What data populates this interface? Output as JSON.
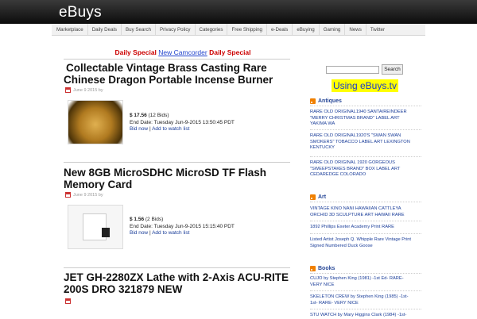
{
  "site": {
    "title": "eBuys"
  },
  "nav": [
    "Marketplace",
    "Daily Deals",
    "Buy Search",
    "Privacy Policy",
    "Categories",
    "Free Shipping",
    "e-Deals",
    "eBuying",
    "Gaming",
    "News",
    "Twitter"
  ],
  "daily_special": {
    "left": "Daily Special",
    "link": "New Camcorder",
    "right": "Daily Special"
  },
  "posts": [
    {
      "title_l1": "Collectable Vintage Brass Casting Rare",
      "title_l2": "Chinese Dragon Portable Incense Burner",
      "meta": "June 9 2015 by",
      "price": "$ 17.56",
      "bids": "(12 Bids)",
      "end": "End Date: Tuesday Jun-9-2015 13:50:45 PDT",
      "bid_now": "Bid now",
      "sep": "|",
      "watch": "Add to watch list"
    },
    {
      "title_l1": "New 8GB MicroSDHC MicroSD TF Flash",
      "title_l2": "Memory Card",
      "meta": "June 9 2015 by",
      "price": "$ 1.56",
      "bids": "(2 Bids)",
      "end": "End Date: Tuesday Jun-9-2015 15:15:40 PDT",
      "bid_now": "Bid now",
      "sep": "|",
      "watch": "Add to watch list"
    },
    {
      "title_l1": "JET GH-2280ZX Lathe with 2-Axis ACU-RITE",
      "title_l2": "200S DRO 321879 NEW"
    }
  ],
  "sidebar": {
    "search_button": "Search",
    "using": "Using eBuys.tv",
    "sections": [
      {
        "title": "Antiques",
        "links": [
          [
            "RARE OLD ORIGINAL1940 SANTA/REINDEER",
            "\"MERRY CHRISTMAS BRAND\" LABEL ART",
            "YAKIMA WA"
          ],
          [
            "RARE OLD ORIGINAL1920'S \"SWAN SWAN",
            "SMOKERS\" TOBACCO LABEL ART LEXINGTON",
            "KENTUCKY"
          ],
          [
            "RARE OLD ORIGINAL 1920 GORGEOUS",
            "\"SWEEPSTAKES BRAND\" BOX LABEL ART",
            "CEDAREDGE COLORADO"
          ]
        ]
      },
      {
        "title": "Art",
        "links": [
          [
            "VINTAGE KINO NANI HAWAIIAN CATTLEYA",
            "ORCHID 3D SCULPTURE ART HAWAII RARE"
          ],
          [
            "1892 Phillips Exeter Academy Print RARE"
          ],
          [
            "Listed Artist Joseph Q. Whipple Rare Vintage Print",
            "Signed Numbered Duck Goose"
          ]
        ]
      },
      {
        "title": "Books",
        "links": [
          [
            "CUJO by Stephen King (1981) -1st Ed- RARE-",
            "VERY NICE"
          ],
          [
            "SKELETON CREW by Stephen King (1985) -1st-",
            "1st- RARE- VERY NICE"
          ],
          [
            "STU WATCH by Mary Higgins Clark (1984) -1st-"
          ]
        ]
      }
    ]
  },
  "colors": {
    "accent_red": "#cc0000",
    "link_blue": "#1a3d99",
    "highlight_yellow": "#ffff00",
    "rss_orange": "#f08000"
  }
}
